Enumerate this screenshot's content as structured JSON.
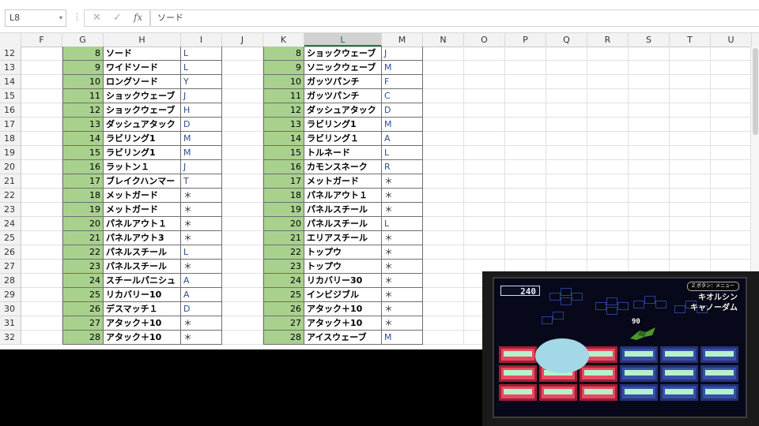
{
  "formula_bar": {
    "name_box": "L8",
    "formula": "ソード",
    "fx_label": "fx",
    "cancel_glyph": "✕",
    "enter_glyph": "✓",
    "sep_glyph": "⋮"
  },
  "columns": [
    "F",
    "G",
    "H",
    "I",
    "J",
    "K",
    "L",
    "M",
    "N",
    "O",
    "P",
    "Q",
    "R",
    "S",
    "T",
    "U"
  ],
  "rows": [
    {
      "r": "12",
      "g": "8",
      "h": "ソード",
      "i": "L",
      "k": "8",
      "l": "ショックウェーブ",
      "m": "J"
    },
    {
      "r": "13",
      "g": "9",
      "h": "ワイドソード",
      "i": "L",
      "k": "9",
      "l": "ソニックウェーブ",
      "m": "M"
    },
    {
      "r": "14",
      "g": "10",
      "h": "ロングソード",
      "i": "Y",
      "k": "10",
      "l": "ガッツパンチ",
      "m": "F"
    },
    {
      "r": "15",
      "g": "11",
      "h": "ショックウェーブ",
      "i": "J",
      "k": "11",
      "l": "ガッツパンチ",
      "m": "C"
    },
    {
      "r": "16",
      "g": "12",
      "h": "ショックウェーブ",
      "i": "H",
      "k": "12",
      "l": "ダッシュアタック",
      "m": "D"
    },
    {
      "r": "17",
      "g": "13",
      "h": "ダッシュアタック",
      "i": "D",
      "k": "13",
      "l": "ラビリング1",
      "m": "M"
    },
    {
      "r": "18",
      "g": "14",
      "h": "ラビリング1",
      "i": "M",
      "k": "14",
      "l": "ラビリング１",
      "m": "A"
    },
    {
      "r": "19",
      "g": "15",
      "h": "ラビリング1",
      "i": "M",
      "k": "15",
      "l": "トルネード",
      "m": "L"
    },
    {
      "r": "20",
      "g": "16",
      "h": "ラットン１",
      "i": "J",
      "k": "16",
      "l": "カモンスネーク",
      "m": "R"
    },
    {
      "r": "21",
      "g": "17",
      "h": "ブレイクハンマー",
      "i": "T",
      "k": "17",
      "l": "メットガード",
      "m": "＊"
    },
    {
      "r": "22",
      "g": "18",
      "h": "メットガード",
      "i": "＊",
      "k": "18",
      "l": "パネルアウト１",
      "m": "＊"
    },
    {
      "r": "23",
      "g": "19",
      "h": "メットガード",
      "i": "＊",
      "k": "19",
      "l": "パネルスチール",
      "m": "＊"
    },
    {
      "r": "24",
      "g": "20",
      "h": "パネルアウト１",
      "i": "＊",
      "k": "20",
      "l": "パネルスチール",
      "m": "L"
    },
    {
      "r": "25",
      "g": "21",
      "h": "パネルアウト3",
      "i": "＊",
      "k": "21",
      "l": "エリアスチール",
      "m": "＊"
    },
    {
      "r": "26",
      "g": "22",
      "h": "パネルスチール",
      "i": "L",
      "k": "22",
      "l": "トップウ",
      "m": "＊"
    },
    {
      "r": "27",
      "g": "23",
      "h": "パネルスチール",
      "i": "＊",
      "k": "23",
      "l": "トップウ",
      "m": "＊"
    },
    {
      "r": "28",
      "g": "24",
      "h": "スチールパニシュ",
      "i": "A",
      "k": "24",
      "l": "リカバリー30",
      "m": "＊"
    },
    {
      "r": "29",
      "g": "25",
      "h": "リカバリー10",
      "i": "A",
      "k": "25",
      "l": "インビジブル",
      "m": "＊"
    },
    {
      "r": "30",
      "g": "26",
      "h": "デスマッチ１",
      "i": "D",
      "k": "26",
      "l": "アタック＋10",
      "m": "＊"
    },
    {
      "r": "31",
      "g": "27",
      "h": "アタック＋10",
      "i": "＊",
      "k": "27",
      "l": "アタック＋10",
      "m": "＊"
    },
    {
      "r": "32",
      "g": "28",
      "h": "アタック＋10",
      "i": "＊",
      "k": "28",
      "l": "アイスウェーブ",
      "m": "M"
    }
  ],
  "game": {
    "player_hp": "240",
    "hint": "Z ボタン：メニュー",
    "enemy_line1": "キオルシン",
    "enemy_line2": "キャノーダム",
    "enemy_hp": "90"
  }
}
